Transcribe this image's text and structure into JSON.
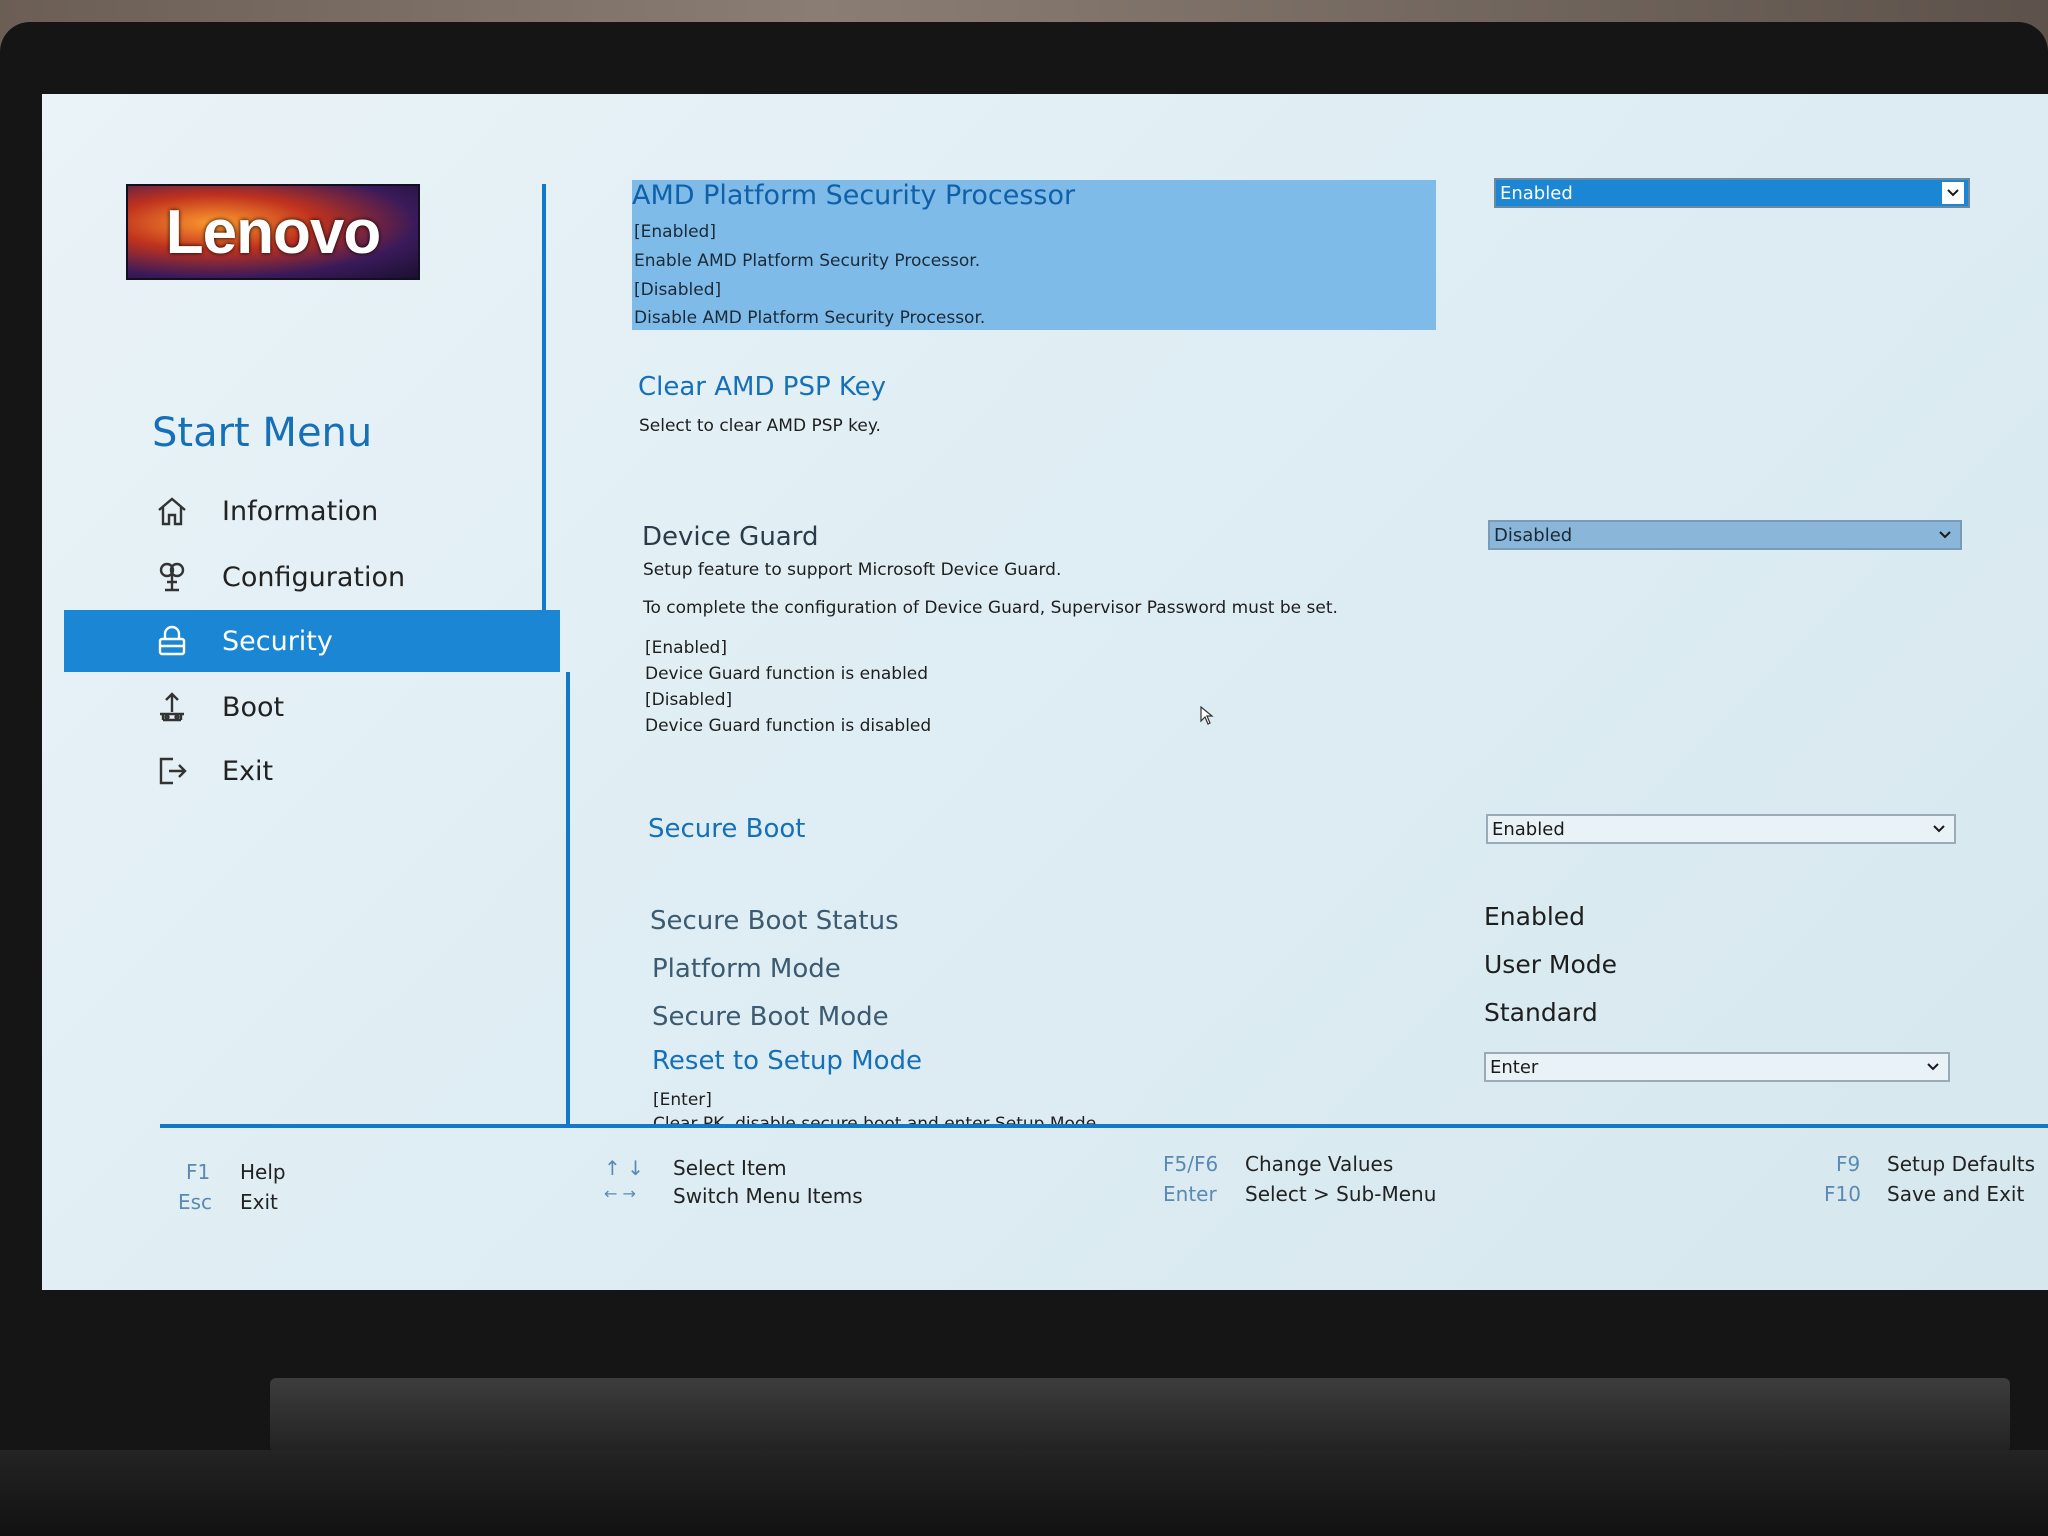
{
  "brand": {
    "logo_text": "Lenovo"
  },
  "sidebar": {
    "title": "Start Menu",
    "items": [
      {
        "label": "Information",
        "icon": "home-icon"
      },
      {
        "label": "Configuration",
        "icon": "configuration-icon"
      },
      {
        "label": "Security",
        "icon": "lock-icon",
        "active": true
      },
      {
        "label": "Boot",
        "icon": "boot-icon"
      },
      {
        "label": "Exit",
        "icon": "exit-icon"
      }
    ]
  },
  "settings": {
    "amd_psp": {
      "title": "AMD Platform Security Processor",
      "lines": [
        "[Enabled]",
        "Enable AMD Platform Security Processor.",
        "[Disabled]",
        "Disable AMD Platform Security Processor."
      ],
      "value": "Enabled"
    },
    "clear_psp": {
      "title": "Clear AMD PSP Key",
      "desc": "Select to clear AMD PSP key."
    },
    "device_guard": {
      "title": "Device Guard",
      "desc1": "Setup feature to support Microsoft Device Guard.",
      "desc2": "To complete the configuration of Device Guard, Supervisor Password must be set.",
      "lines": [
        "[Enabled]",
        "Device Guard function is enabled",
        "[Disabled]",
        "Device Guard function is disabled"
      ],
      "value": "Disabled"
    },
    "secure_boot": {
      "title": "Secure Boot",
      "value": "Enabled"
    },
    "secure_boot_status": {
      "title": "Secure Boot Status",
      "value": "Enabled"
    },
    "platform_mode": {
      "title": "Platform Mode",
      "value": "User Mode"
    },
    "secure_boot_mode": {
      "title": "Secure Boot Mode",
      "value": "Standard"
    },
    "reset_setup": {
      "title": "Reset to Setup Mode",
      "value": "Enter",
      "line1": "[Enter]",
      "line2": "Clear PK, disable secure boot and enter Setup Mode"
    }
  },
  "footer": {
    "f1_key": "F1",
    "f1_label": "Help",
    "esc_key": "Esc",
    "esc_label": "Exit",
    "updown_key": "↑ ↓",
    "updown_label": "Select Item",
    "leftright_key": "← →",
    "leftright_label": "Switch Menu Items",
    "f5f6_key": "F5/F6",
    "f5f6_label": "Change Values",
    "enter_key": "Enter",
    "enter_label": "Select > Sub-Menu",
    "f9_key": "F9",
    "f9_label": "Setup Defaults",
    "f10_key": "F10",
    "f10_label": "Save and Exit"
  },
  "colors": {
    "accent": "#1a86d4",
    "highlight": "#7fbbe8",
    "screen_bg": "#e3f0f5"
  }
}
